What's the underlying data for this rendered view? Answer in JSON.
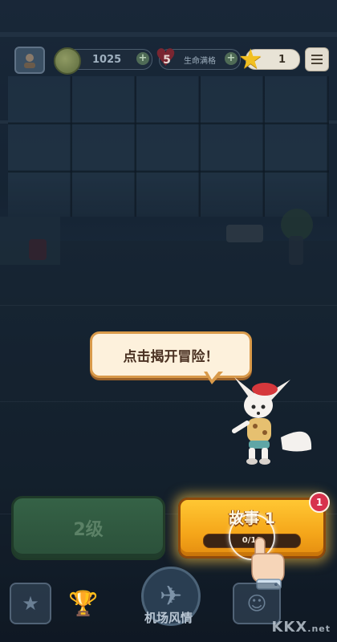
{
  "hud": {
    "coins": "1025",
    "lives": "5",
    "lives_label": "生命满格",
    "stars": "1",
    "profile_icon": "avatar-icon",
    "menu_icon": "hamburger-menu-icon"
  },
  "bubble": {
    "text": "点击揭开冒险！"
  },
  "level_button": {
    "label": "2级"
  },
  "story_button": {
    "title": "故事 1",
    "progress_text": "0/10",
    "progress_fraction": 0.0,
    "badge": "1"
  },
  "bottom_nav": {
    "center_label": "机场风情",
    "left_icon": "book-star-icon",
    "trophy_icon": "trophy-icon",
    "center_icon": "airplane-icon",
    "right_icon": "team-icon"
  },
  "watermark": {
    "text": "KKX",
    "suffix": ".net"
  },
  "colors": {
    "story_gold": "#f5a61a",
    "level_green": "#356246",
    "badge_red": "#d7324d",
    "bubble_bg": "#fdf1dc"
  }
}
